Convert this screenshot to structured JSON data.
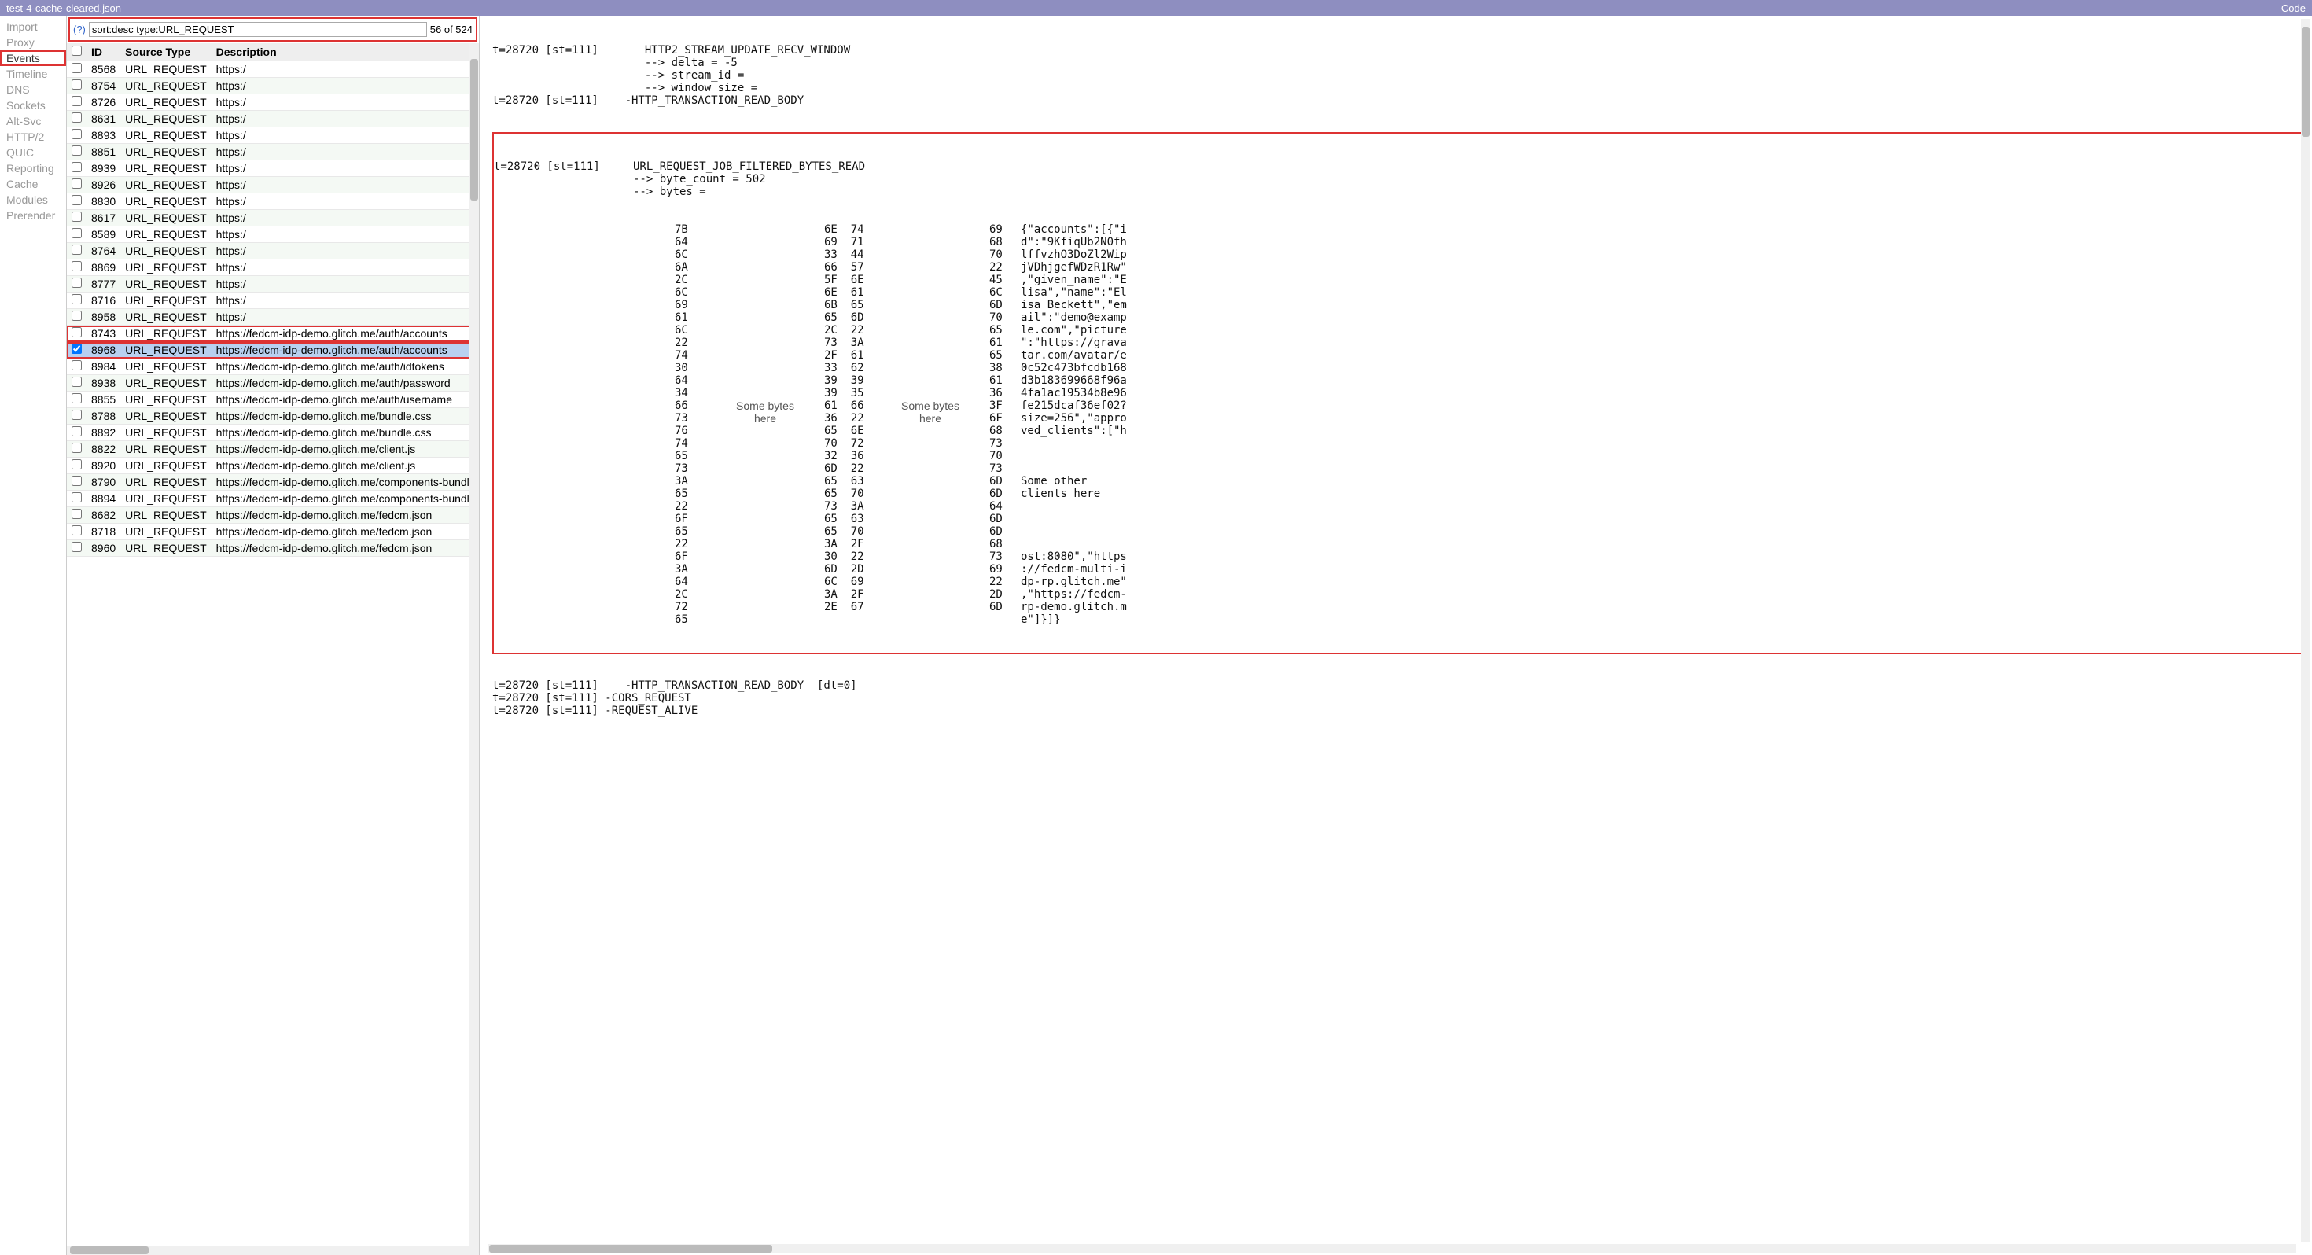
{
  "titlebar": {
    "filename": "test-4-cache-cleared.json",
    "code_link": "Code"
  },
  "sidebar": {
    "items": [
      "Import",
      "Proxy",
      "Events",
      "Timeline",
      "DNS",
      "Sockets",
      "Alt-Svc",
      "HTTP/2",
      "QUIC",
      "Reporting",
      "Cache",
      "Modules",
      "Prerender"
    ],
    "active_index": 2
  },
  "filter": {
    "help": "(?)",
    "value": "sort:desc type:URL_REQUEST",
    "count": "56 of 524"
  },
  "columns": {
    "cb": "",
    "id": "ID",
    "src": "Source Type",
    "desc": "Description"
  },
  "rows": [
    {
      "id": "8568",
      "src": "URL_REQUEST",
      "desc": "https:/",
      "cb": false
    },
    {
      "id": "8754",
      "src": "URL_REQUEST",
      "desc": "https:/",
      "cb": false
    },
    {
      "id": "8726",
      "src": "URL_REQUEST",
      "desc": "https:/",
      "cb": false
    },
    {
      "id": "8631",
      "src": "URL_REQUEST",
      "desc": "https:/",
      "cb": false
    },
    {
      "id": "8893",
      "src": "URL_REQUEST",
      "desc": "https:/",
      "cb": false
    },
    {
      "id": "8851",
      "src": "URL_REQUEST",
      "desc": "https:/",
      "cb": false
    },
    {
      "id": "8939",
      "src": "URL_REQUEST",
      "desc": "https:/",
      "cb": false
    },
    {
      "id": "8926",
      "src": "URL_REQUEST",
      "desc": "https:/",
      "cb": false
    },
    {
      "id": "8830",
      "src": "URL_REQUEST",
      "desc": "https:/",
      "cb": false
    },
    {
      "id": "8617",
      "src": "URL_REQUEST",
      "desc": "https:/",
      "cb": false
    },
    {
      "id": "8589",
      "src": "URL_REQUEST",
      "desc": "https:/",
      "cb": false
    },
    {
      "id": "8764",
      "src": "URL_REQUEST",
      "desc": "https:/",
      "cb": false
    },
    {
      "id": "8869",
      "src": "URL_REQUEST",
      "desc": "https:/",
      "cb": false
    },
    {
      "id": "8777",
      "src": "URL_REQUEST",
      "desc": "https:/",
      "cb": false
    },
    {
      "id": "8716",
      "src": "URL_REQUEST",
      "desc": "https:/",
      "cb": false
    },
    {
      "id": "8958",
      "src": "URL_REQUEST",
      "desc": "https:/",
      "cb": false
    },
    {
      "id": "8743",
      "src": "URL_REQUEST",
      "desc": "https://fedcm-idp-demo.glitch.me/auth/accounts",
      "cb": false,
      "hl": true
    },
    {
      "id": "8968",
      "src": "URL_REQUEST",
      "desc": "https://fedcm-idp-demo.glitch.me/auth/accounts",
      "cb": true,
      "selected": true,
      "hl": true
    },
    {
      "id": "8984",
      "src": "URL_REQUEST",
      "desc": "https://fedcm-idp-demo.glitch.me/auth/idtokens",
      "cb": false
    },
    {
      "id": "8938",
      "src": "URL_REQUEST",
      "desc": "https://fedcm-idp-demo.glitch.me/auth/password",
      "cb": false
    },
    {
      "id": "8855",
      "src": "URL_REQUEST",
      "desc": "https://fedcm-idp-demo.glitch.me/auth/username",
      "cb": false
    },
    {
      "id": "8788",
      "src": "URL_REQUEST",
      "desc": "https://fedcm-idp-demo.glitch.me/bundle.css",
      "cb": false
    },
    {
      "id": "8892",
      "src": "URL_REQUEST",
      "desc": "https://fedcm-idp-demo.glitch.me/bundle.css",
      "cb": false
    },
    {
      "id": "8822",
      "src": "URL_REQUEST",
      "desc": "https://fedcm-idp-demo.glitch.me/client.js",
      "cb": false
    },
    {
      "id": "8920",
      "src": "URL_REQUEST",
      "desc": "https://fedcm-idp-demo.glitch.me/client.js",
      "cb": false
    },
    {
      "id": "8790",
      "src": "URL_REQUEST",
      "desc": "https://fedcm-idp-demo.glitch.me/components-bundle.j",
      "cb": false
    },
    {
      "id": "8894",
      "src": "URL_REQUEST",
      "desc": "https://fedcm-idp-demo.glitch.me/components-bundle.j",
      "cb": false
    },
    {
      "id": "8682",
      "src": "URL_REQUEST",
      "desc": "https://fedcm-idp-demo.glitch.me/fedcm.json",
      "cb": false
    },
    {
      "id": "8718",
      "src": "URL_REQUEST",
      "desc": "https://fedcm-idp-demo.glitch.me/fedcm.json",
      "cb": false
    },
    {
      "id": "8960",
      "src": "URL_REQUEST",
      "desc": "https://fedcm-idp-demo.glitch.me/fedcm.json",
      "cb": false
    }
  ],
  "header_lines": [
    "t=28720 [st=111]       HTTP2_STREAM_UPDATE_RECV_WINDOW",
    "                       --> delta = -5",
    "                       --> stream_id =",
    "                       --> window_size =",
    "t=28720 [st=111]    -HTTP_TRANSACTION_READ_BODY"
  ],
  "redbox_header": [
    "t=28720 [st=111]     URL_REQUEST_JOB_FILTERED_BYTES_READ",
    "                     --> byte_count = 502",
    "                     --> bytes ="
  ],
  "hex_rows": [
    {
      "c1": "7B",
      "c2": "6E  74",
      "c3": "69",
      "a": "{\"accounts\":[{\"i"
    },
    {
      "c1": "64",
      "c2": "69  71",
      "c3": "68",
      "a": "d\":\"9KfiqUb2N0fh"
    },
    {
      "c1": "6C",
      "c2": "33  44",
      "c3": "70",
      "a": "lffvzhO3DoZl2Wip"
    },
    {
      "c1": "6A",
      "c2": "66  57",
      "c3": "22",
      "a": "jVDhjgefWDzR1Rw\""
    },
    {
      "c1": "2C",
      "c2": "5F  6E",
      "c3": "45",
      "a": ",\"given_name\":\"E"
    },
    {
      "c1": "6C",
      "c2": "6E  61",
      "c3": "6C",
      "a": "lisa\",\"name\":\"El"
    },
    {
      "c1": "69",
      "c2": "6B  65",
      "c3": "6D",
      "a": "isa Beckett\",\"em"
    },
    {
      "c1": "61",
      "c2": "65  6D",
      "c3": "70",
      "a": "ail\":\"demo@examp"
    },
    {
      "c1": "6C",
      "c2": "2C  22",
      "c3": "65",
      "a": "le.com\",\"picture"
    },
    {
      "c1": "22",
      "c2": "73  3A",
      "c3": "61",
      "a": "\":\"https://grava"
    },
    {
      "c1": "74",
      "c2": "2F  61",
      "c3": "65",
      "a": "tar.com/avatar/e"
    },
    {
      "c1": "30",
      "c2": "33  62",
      "c3": "38",
      "a": "0c52c473bfcdb168"
    },
    {
      "c1": "64",
      "c2": "39  39",
      "c3": "61",
      "a": "d3b183699668f96a"
    },
    {
      "c1": "34",
      "c2": "39  35",
      "c3": "36",
      "a": "4fa1ac19534b8e96"
    },
    {
      "c1": "66",
      "g1": "Some bytes",
      "c2": "61  66",
      "g2": "Some bytes",
      "c3": "3F",
      "a": "fe215dcaf36ef02?"
    },
    {
      "c1": "73",
      "g1": "here",
      "c2": "36  22",
      "g2": "here",
      "c3": "6F",
      "a": "size=256\",\"appro"
    },
    {
      "c1": "76",
      "c2": "65  6E",
      "c3": "68",
      "a": "ved_clients\":[\"h"
    },
    {
      "c1": "74",
      "c2": "70  72",
      "c3": "73",
      "a": ""
    },
    {
      "c1": "65",
      "c2": "32  36",
      "c3": "70",
      "a": ""
    },
    {
      "c1": "73",
      "c2": "6D  22",
      "c3": "73",
      "a": ""
    },
    {
      "c1": "3A",
      "c2": "65  63",
      "c3": "6D",
      "a": "Some other"
    },
    {
      "c1": "65",
      "c2": "65  70",
      "c3": "6D",
      "a": "clients here"
    },
    {
      "c1": "22",
      "c2": "73  3A",
      "c3": "64",
      "a": ""
    },
    {
      "c1": "6F",
      "c2": "65  63",
      "c3": "6D",
      "a": ""
    },
    {
      "c1": "65",
      "c2": "65  70",
      "c3": "6D",
      "a": ""
    },
    {
      "c1": "22",
      "c2": "3A  2F",
      "c3": "68",
      "a": ""
    },
    {
      "c1": "6F",
      "c2": "30  22",
      "c3": "73",
      "a": "ost:8080\",\"https"
    },
    {
      "c1": "3A",
      "c2": "6D  2D",
      "c3": "69",
      "a": "://fedcm-multi-i"
    },
    {
      "c1": "64",
      "c2": "6C  69",
      "c3": "22",
      "a": "dp-rp.glitch.me\""
    },
    {
      "c1": "2C",
      "c2": "3A  2F",
      "c3": "2D",
      "a": ",\"https://fedcm-"
    },
    {
      "c1": "72",
      "c2": "2E  67",
      "c3": "6D",
      "a": "rp-demo.glitch.m"
    },
    {
      "c1": "65",
      "c2": "",
      "c3": "",
      "a": "e\"]}]}"
    }
  ],
  "footer_lines": [
    "t=28720 [st=111]    -HTTP_TRANSACTION_READ_BODY  [dt=0]",
    "t=28720 [st=111] -CORS_REQUEST",
    "t=28720 [st=111] -REQUEST_ALIVE"
  ]
}
